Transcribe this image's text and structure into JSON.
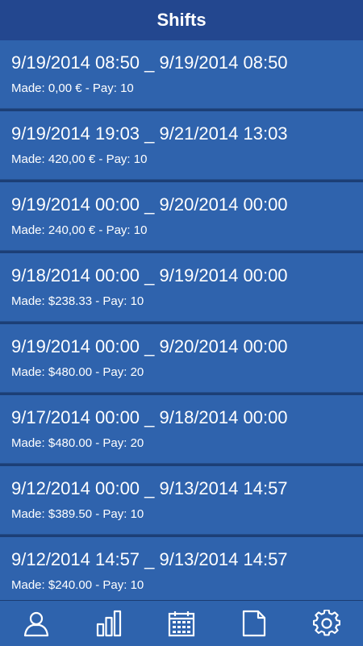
{
  "header": {
    "title": "Shifts"
  },
  "shifts": [
    {
      "range": "9/19/2014 08:50 _ 9/19/2014 08:50",
      "details": "Made: 0,00 € - Pay: 10"
    },
    {
      "range": "9/19/2014 19:03 _ 9/21/2014 13:03",
      "details": "Made: 420,00 € - Pay: 10"
    },
    {
      "range": "9/19/2014 00:00 _ 9/20/2014 00:00",
      "details": "Made: 240,00 € - Pay: 10"
    },
    {
      "range": "9/18/2014 00:00 _ 9/19/2014 00:00",
      "details": "Made: $238.33 - Pay: 10"
    },
    {
      "range": "9/19/2014 00:00 _ 9/20/2014 00:00",
      "details": "Made: $480.00 - Pay: 20"
    },
    {
      "range": "9/17/2014 00:00 _ 9/18/2014 00:00",
      "details": "Made: $480.00 - Pay: 20"
    },
    {
      "range": "9/12/2014 00:00 _ 9/13/2014 14:57",
      "details": "Made: $389.50 - Pay: 10"
    },
    {
      "range": "9/12/2014 14:57 _ 9/13/2014 14:57",
      "details": "Made: $240.00 - Pay: 10"
    }
  ],
  "nav": {
    "items": [
      {
        "icon": "user-icon"
      },
      {
        "icon": "bar-chart-icon"
      },
      {
        "icon": "calendar-icon"
      },
      {
        "icon": "document-icon"
      },
      {
        "icon": "gear-icon"
      }
    ]
  },
  "colors": {
    "header_bg": "#23478f",
    "row_bg": "#2f63ad",
    "nav_bg": "#2e63ad",
    "text": "#ffffff"
  }
}
